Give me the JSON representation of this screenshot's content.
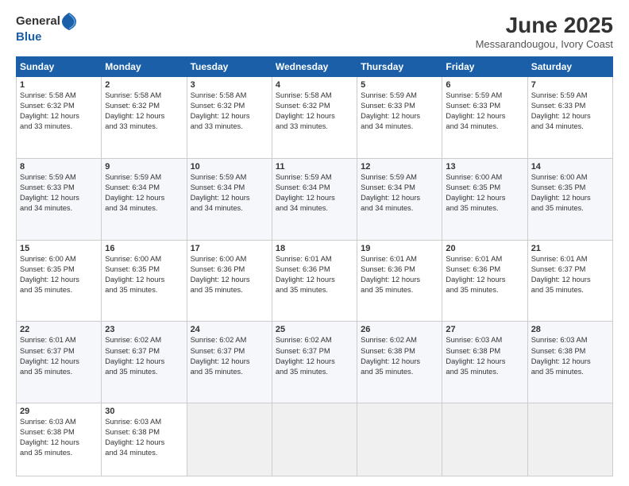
{
  "header": {
    "logo_general": "General",
    "logo_blue": "Blue",
    "month_title": "June 2025",
    "location": "Messarandougou, Ivory Coast"
  },
  "days_of_week": [
    "Sunday",
    "Monday",
    "Tuesday",
    "Wednesday",
    "Thursday",
    "Friday",
    "Saturday"
  ],
  "weeks": [
    [
      {
        "day": 1,
        "info": "Sunrise: 5:58 AM\nSunset: 6:32 PM\nDaylight: 12 hours\nand 33 minutes."
      },
      {
        "day": 2,
        "info": "Sunrise: 5:58 AM\nSunset: 6:32 PM\nDaylight: 12 hours\nand 33 minutes."
      },
      {
        "day": 3,
        "info": "Sunrise: 5:58 AM\nSunset: 6:32 PM\nDaylight: 12 hours\nand 33 minutes."
      },
      {
        "day": 4,
        "info": "Sunrise: 5:58 AM\nSunset: 6:32 PM\nDaylight: 12 hours\nand 33 minutes."
      },
      {
        "day": 5,
        "info": "Sunrise: 5:59 AM\nSunset: 6:33 PM\nDaylight: 12 hours\nand 34 minutes."
      },
      {
        "day": 6,
        "info": "Sunrise: 5:59 AM\nSunset: 6:33 PM\nDaylight: 12 hours\nand 34 minutes."
      },
      {
        "day": 7,
        "info": "Sunrise: 5:59 AM\nSunset: 6:33 PM\nDaylight: 12 hours\nand 34 minutes."
      }
    ],
    [
      {
        "day": 8,
        "info": "Sunrise: 5:59 AM\nSunset: 6:33 PM\nDaylight: 12 hours\nand 34 minutes."
      },
      {
        "day": 9,
        "info": "Sunrise: 5:59 AM\nSunset: 6:34 PM\nDaylight: 12 hours\nand 34 minutes."
      },
      {
        "day": 10,
        "info": "Sunrise: 5:59 AM\nSunset: 6:34 PM\nDaylight: 12 hours\nand 34 minutes."
      },
      {
        "day": 11,
        "info": "Sunrise: 5:59 AM\nSunset: 6:34 PM\nDaylight: 12 hours\nand 34 minutes."
      },
      {
        "day": 12,
        "info": "Sunrise: 5:59 AM\nSunset: 6:34 PM\nDaylight: 12 hours\nand 34 minutes."
      },
      {
        "day": 13,
        "info": "Sunrise: 6:00 AM\nSunset: 6:35 PM\nDaylight: 12 hours\nand 35 minutes."
      },
      {
        "day": 14,
        "info": "Sunrise: 6:00 AM\nSunset: 6:35 PM\nDaylight: 12 hours\nand 35 minutes."
      }
    ],
    [
      {
        "day": 15,
        "info": "Sunrise: 6:00 AM\nSunset: 6:35 PM\nDaylight: 12 hours\nand 35 minutes."
      },
      {
        "day": 16,
        "info": "Sunrise: 6:00 AM\nSunset: 6:35 PM\nDaylight: 12 hours\nand 35 minutes."
      },
      {
        "day": 17,
        "info": "Sunrise: 6:00 AM\nSunset: 6:36 PM\nDaylight: 12 hours\nand 35 minutes."
      },
      {
        "day": 18,
        "info": "Sunrise: 6:01 AM\nSunset: 6:36 PM\nDaylight: 12 hours\nand 35 minutes."
      },
      {
        "day": 19,
        "info": "Sunrise: 6:01 AM\nSunset: 6:36 PM\nDaylight: 12 hours\nand 35 minutes."
      },
      {
        "day": 20,
        "info": "Sunrise: 6:01 AM\nSunset: 6:36 PM\nDaylight: 12 hours\nand 35 minutes."
      },
      {
        "day": 21,
        "info": "Sunrise: 6:01 AM\nSunset: 6:37 PM\nDaylight: 12 hours\nand 35 minutes."
      }
    ],
    [
      {
        "day": 22,
        "info": "Sunrise: 6:01 AM\nSunset: 6:37 PM\nDaylight: 12 hours\nand 35 minutes."
      },
      {
        "day": 23,
        "info": "Sunrise: 6:02 AM\nSunset: 6:37 PM\nDaylight: 12 hours\nand 35 minutes."
      },
      {
        "day": 24,
        "info": "Sunrise: 6:02 AM\nSunset: 6:37 PM\nDaylight: 12 hours\nand 35 minutes."
      },
      {
        "day": 25,
        "info": "Sunrise: 6:02 AM\nSunset: 6:37 PM\nDaylight: 12 hours\nand 35 minutes."
      },
      {
        "day": 26,
        "info": "Sunrise: 6:02 AM\nSunset: 6:38 PM\nDaylight: 12 hours\nand 35 minutes."
      },
      {
        "day": 27,
        "info": "Sunrise: 6:03 AM\nSunset: 6:38 PM\nDaylight: 12 hours\nand 35 minutes."
      },
      {
        "day": 28,
        "info": "Sunrise: 6:03 AM\nSunset: 6:38 PM\nDaylight: 12 hours\nand 35 minutes."
      }
    ],
    [
      {
        "day": 29,
        "info": "Sunrise: 6:03 AM\nSunset: 6:38 PM\nDaylight: 12 hours\nand 35 minutes."
      },
      {
        "day": 30,
        "info": "Sunrise: 6:03 AM\nSunset: 6:38 PM\nDaylight: 12 hours\nand 34 minutes."
      },
      null,
      null,
      null,
      null,
      null
    ]
  ]
}
